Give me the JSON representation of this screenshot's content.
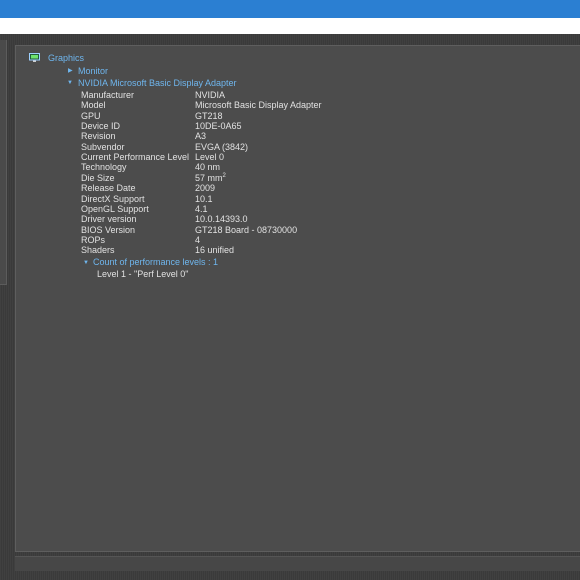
{
  "tree": {
    "root_label": "Graphics",
    "monitor_label": "Monitor",
    "adapter_label": "NVIDIA Microsoft Basic Display Adapter",
    "properties": [
      {
        "label": "Manufacturer",
        "value": "NVIDIA"
      },
      {
        "label": "Model",
        "value": "Microsoft Basic Display Adapter"
      },
      {
        "label": "GPU",
        "value": "GT218"
      },
      {
        "label": "Device ID",
        "value": "10DE-0A65"
      },
      {
        "label": "Revision",
        "value": "A3"
      },
      {
        "label": "Subvendor",
        "value": "EVGA (3842)"
      },
      {
        "label": "Current Performance Level",
        "value": "Level 0"
      },
      {
        "label": "Technology",
        "value": "40 nm"
      },
      {
        "label": "Die Size",
        "value": "57 mm",
        "value_sup": "2"
      },
      {
        "label": "Release Date",
        "value": "2009"
      },
      {
        "label": "DirectX Support",
        "value": "10.1"
      },
      {
        "label": "OpenGL Support",
        "value": "4.1"
      },
      {
        "label": "Driver version",
        "value": "10.0.14393.0"
      },
      {
        "label": "BIOS Version",
        "value": "GT218 Board - 08730000"
      },
      {
        "label": "ROPs",
        "value": "4"
      },
      {
        "label": "Shaders",
        "value": "16 unified"
      }
    ],
    "perf_levels_label": "Count of performance levels : 1",
    "perf_level_item": "Level 1 - \"Perf Level 0\""
  },
  "colors": {
    "titlebar": "#2b7fd2",
    "link": "#6fb6ee",
    "panel": "#4c4c4c"
  },
  "icons": {
    "root": "monitor-icon",
    "collapsed": "triangle-right-icon",
    "expanded": "triangle-down-icon"
  }
}
